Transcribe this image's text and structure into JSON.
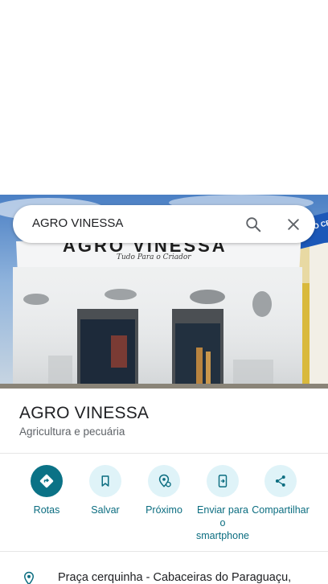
{
  "search": {
    "query": "AGRO VINESSA"
  },
  "photo": {
    "sign_main": "AGRO VINESSA",
    "sign_sub": "Tudo Para o Criador",
    "side_sign": "POVO CERQUI"
  },
  "place": {
    "name": "AGRO VINESSA",
    "category": "Agricultura e pecuária"
  },
  "actions": [
    {
      "label": "Rotas",
      "icon": "directions-icon"
    },
    {
      "label": "Salvar",
      "icon": "bookmark-icon"
    },
    {
      "label": "Próximo",
      "icon": "nearby-icon"
    },
    {
      "label": "Enviar para o smartphone",
      "icon": "send-to-phone-icon"
    },
    {
      "label": "Compartilhar",
      "icon": "share-icon"
    }
  ],
  "address": {
    "text": "Praça cerquinha - Cabaceiras do Paraguaçu,"
  },
  "colors": {
    "accent": "#0b7286",
    "action_bg": "#dff3f8",
    "action_text": "#0b6d80",
    "text_primary": "#202124",
    "text_secondary": "#5f6368"
  }
}
